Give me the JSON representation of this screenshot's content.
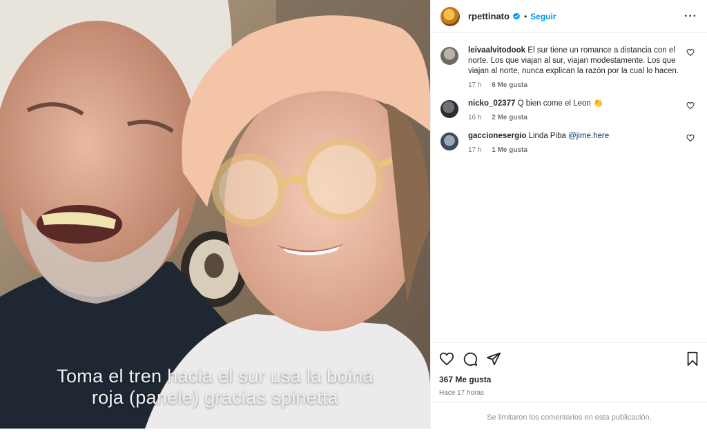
{
  "post": {
    "caption_line1": "Toma el tren hacia el sur usa la boina",
    "caption_line2": "roja (panele) gracias spinetta"
  },
  "header": {
    "username": "rpettinato",
    "dot": "•",
    "follow_label": "Seguir",
    "more_label": "···"
  },
  "comments": [
    {
      "user": "leivaalvitodook",
      "text": "El sur tiene un romance a distancia con el norte. Los que viajan al sur, viajan modestamente. Los que viajan al norte, nunca explican la razón por la cual lo hacen.",
      "time": "17 h",
      "likes": "6 Me gusta"
    },
    {
      "user": "nicko_02377",
      "text": "Q bien come el Leon 👏",
      "time": "16 h",
      "likes": "2 Me gusta"
    },
    {
      "user": "gaccionesergio",
      "text": "Linda Piba ",
      "mention": "@jime.here",
      "time": "17 h",
      "likes": "1 Me gusta"
    }
  ],
  "actions": {
    "like_count": "367 Me gusta",
    "time_ago": "Hace 17 horas"
  },
  "footer": {
    "notice": "Se limitaron los comentarios en esta publicación."
  },
  "colors": {
    "accent": "#0095f6",
    "verified": "#0095f6",
    "mention": "#00376b",
    "secondary_text": "#737373"
  }
}
